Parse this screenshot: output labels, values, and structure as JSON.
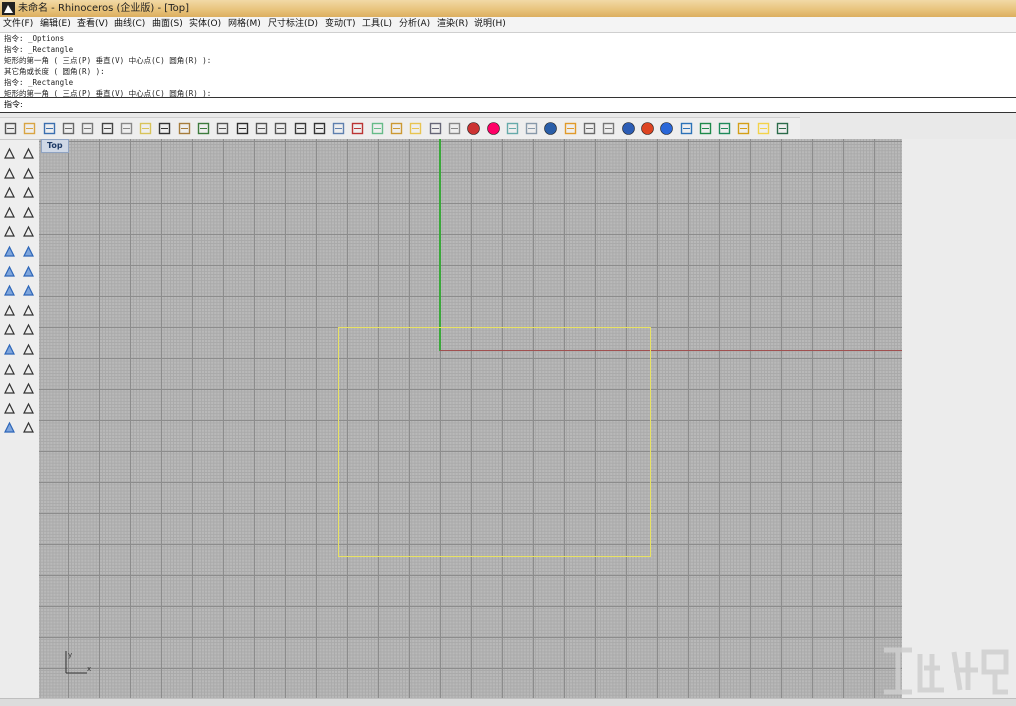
{
  "window": {
    "title": "未命名 - Rhinoceros (企业版) - [Top]"
  },
  "menu": [
    "文件(F)",
    "编辑(E)",
    "查看(V)",
    "曲线(C)",
    "曲面(S)",
    "实体(O)",
    "网格(M)",
    "尺寸标注(D)",
    "变动(T)",
    "工具(L)",
    "分析(A)",
    "渲染(R)",
    "说明(H)"
  ],
  "command_history": [
    "指令: _Options",
    "指令: _Rectangle",
    "矩形的第一角 ( 三点(P) 垂直(V) 中心点(C) 圆角(R) ):",
    "其它角或长度 ( 圆角(R) ):",
    "指令: _Rectangle",
    "矩形的第一角 ( 三点(P) 垂直(V) 中心点(C) 圆角(R) ):"
  ],
  "command_prompt": {
    "label": "指令:",
    "value": ""
  },
  "viewport": {
    "label": "Top",
    "cplane_x": "x",
    "cplane_y": "y"
  },
  "colors": {
    "x_axis": "#a05050",
    "y_axis": "#3aa83a",
    "rectangle": "#e8e262",
    "grid_bg": "#b9b9b9"
  },
  "toolbar_icons": [
    "new-icon",
    "open-icon",
    "save-icon",
    "print-icon",
    "import-icon",
    "cut-icon",
    "copy-icon",
    "paste-icon",
    "undo-icon",
    "pan-icon",
    "rotate-view-icon",
    "zoom-icon",
    "zoom-window-icon",
    "zoom-extents-icon",
    "zoom-selected-icon",
    "undo-view-icon",
    "four-viewports-icon",
    "cplane-icon",
    "hide-icon",
    "show-icon",
    "lock-icon",
    "light-icon",
    "properties-icon",
    "layer-icon",
    "color-wheel-icon",
    "render-preview-icon",
    "wireframe-icon",
    "shaded-icon",
    "render-icon",
    "snap-icon",
    "grid-icon",
    "options-icon",
    "help-icon",
    "material-red-icon",
    "material-blue-icon",
    "cube-icon",
    "shield-icon",
    "texture-icon",
    "cone-icon",
    "star-icon",
    "settings-icon"
  ],
  "left_toolbar_icons": [
    "select-icon",
    "point-icon",
    "polyline-icon",
    "rectangle-sel-icon",
    "circle-icon",
    "ellipse-icon",
    "polygon-icon",
    "rectangle-icon",
    "arc-center-icon",
    "fillet-curve-icon",
    "surface-icon",
    "surface-edit-icon",
    "box-solid-icon",
    "boolean-icon",
    "cylinder-icon",
    "extrude-icon",
    "group-icon",
    "explode-icon",
    "move-icon",
    "cage-icon",
    "mesh-icon",
    "mirror-icon",
    "offset-icon",
    "blend-icon",
    "text-icon",
    "dim-icon",
    "array-icon",
    "transform-icon",
    "render-box-icon",
    "misc-icon"
  ]
}
